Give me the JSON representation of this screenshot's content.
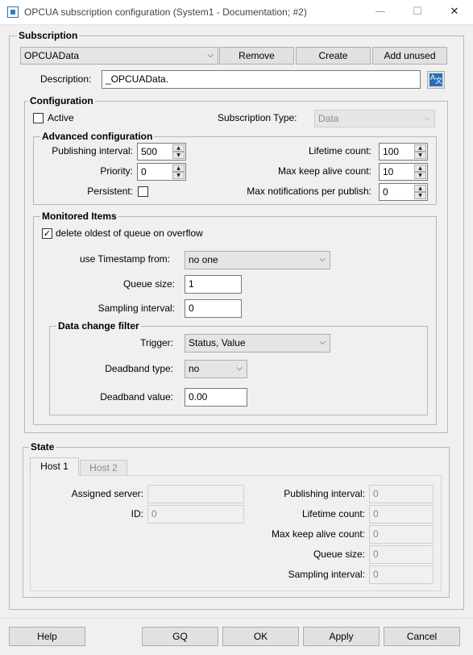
{
  "window": {
    "title": "OPCUA subscription configuration (System1 - Documentation; #2)",
    "minimize_glyph": "—",
    "maximize_glyph": "☐",
    "close_glyph": "✕"
  },
  "subscription": {
    "legend": "Subscription",
    "selected": "OPCUAData",
    "remove_label": "Remove",
    "create_label": "Create",
    "add_unused_label": "Add unused",
    "description_label": "Description:",
    "description_value": "_OPCUAData."
  },
  "configuration": {
    "legend": "Configuration",
    "active_label": "Active",
    "active_checked": false,
    "subscription_type_label": "Subscription Type:",
    "subscription_type_value": "Data"
  },
  "advanced": {
    "legend": "Advanced configuration",
    "publishing_interval_label": "Publishing interval:",
    "publishing_interval_value": "500",
    "priority_label": "Priority:",
    "priority_value": "0",
    "persistent_label": "Persistent:",
    "persistent_checked": false,
    "lifetime_count_label": "Lifetime count:",
    "lifetime_count_value": "100",
    "max_keep_alive_label": "Max keep alive count:",
    "max_keep_alive_value": "10",
    "max_notifications_label": "Max notifications per publish:",
    "max_notifications_value": "0"
  },
  "monitored": {
    "legend": "Monitored Items",
    "delete_oldest_label": "delete oldest of queue on overflow",
    "delete_oldest_checked": true,
    "timestamp_label": "use Timestamp from:",
    "timestamp_value": "no one",
    "queue_size_label": "Queue size:",
    "queue_size_value": "1",
    "sampling_interval_label": "Sampling interval:",
    "sampling_interval_value": "0"
  },
  "filter": {
    "legend": "Data change filter",
    "trigger_label": "Trigger:",
    "trigger_value": "Status, Value",
    "deadband_type_label": "Deadband type:",
    "deadband_type_value": "no",
    "deadband_value_label": "Deadband value:",
    "deadband_value_value": "0.00"
  },
  "state": {
    "legend": "State",
    "tabs": [
      "Host 1",
      "Host 2"
    ],
    "active_tab": 0,
    "assigned_server_label": "Assigned server:",
    "assigned_server_value": "",
    "id_label": "ID:",
    "id_value": "0",
    "publishing_interval_label": "Publishing interval:",
    "publishing_interval_value": "0",
    "lifetime_count_label": "Lifetime count:",
    "lifetime_count_value": "0",
    "max_keep_alive_label": "Max keep alive count:",
    "max_keep_alive_value": "0",
    "queue_size_label": "Queue size:",
    "queue_size_value": "0",
    "sampling_interval_label": "Sampling interval:",
    "sampling_interval_value": "0"
  },
  "buttons": {
    "help": "Help",
    "gq": "GQ",
    "ok": "OK",
    "apply": "Apply",
    "cancel": "Cancel"
  },
  "icons": {
    "chevron_down": "⌵",
    "spin_up": "▲",
    "spin_down": "▼",
    "check": "✓",
    "translate_glyph": "A",
    "translate_glyph2": "文"
  },
  "colors": {
    "background": "#f0f0f0",
    "translate_icon": "#2a6fb5"
  }
}
